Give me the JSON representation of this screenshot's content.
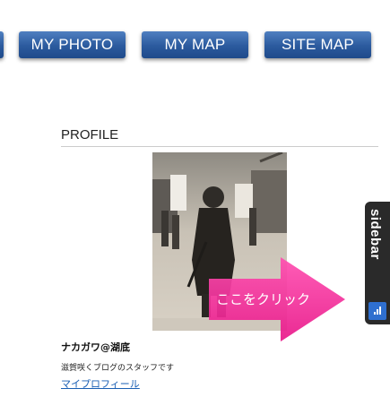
{
  "nav": {
    "left_partial_label": "",
    "photo_label": "MY PHOTO",
    "map_label": "MY MAP",
    "sitemap_label": "SITE MAP"
  },
  "profile": {
    "heading": "PROFILE",
    "name": "ナカガワ@湖底",
    "description": "滋賀咲くブログのスタッフです",
    "link_label": "マイプロフィール",
    "cta_label": "ここをクリック"
  },
  "sidebar_tab": {
    "label": "sidebar"
  },
  "colors": {
    "nav_blue": "#2b5a9e",
    "cta_pink": "#ff3ea5",
    "link_blue": "#1a5fb4",
    "tab_dark": "#2a2a2a"
  }
}
